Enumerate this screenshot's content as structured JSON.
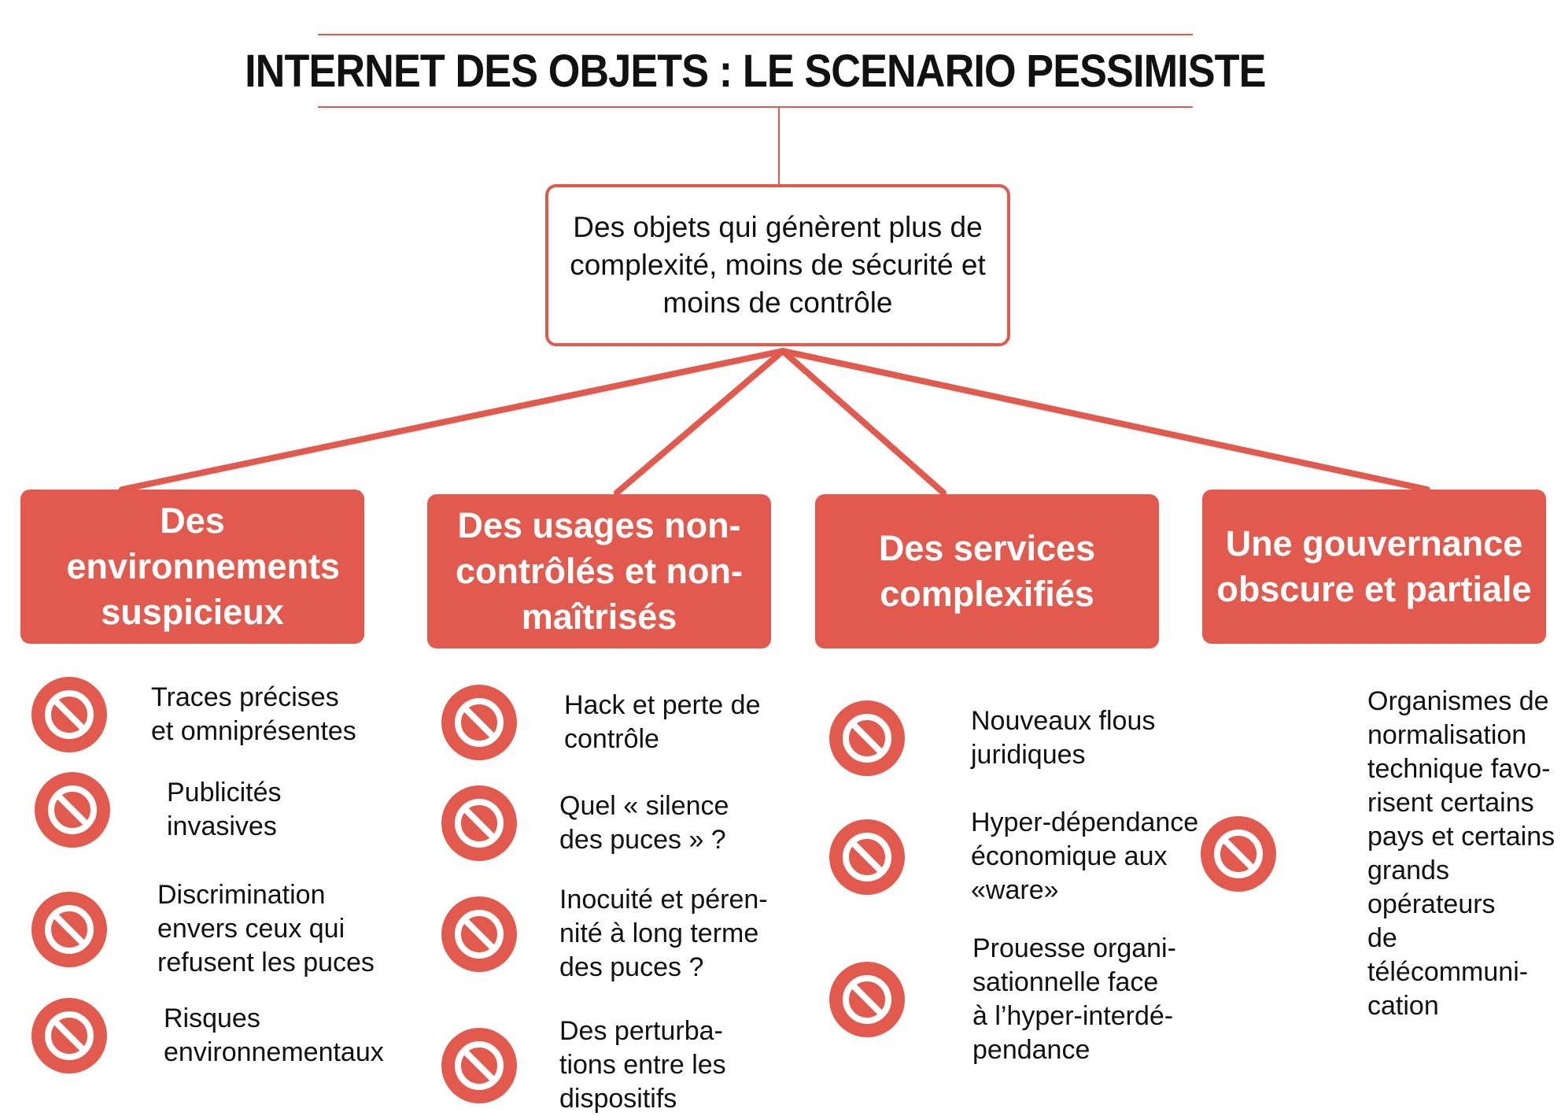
{
  "title": "INTERNET DES OBJETS : LE SCENARIO PESSIMISTE",
  "root": "Des objets qui génèrent plus de complexité, moins de sécurité et moins de contrôle",
  "colors": {
    "accent": "#e25a4d",
    "text": "#111111",
    "background": "#ffffff"
  },
  "icon_name": "no-entry-icon",
  "branches": [
    {
      "label": "Des environnements suspicieux",
      "items": [
        "Traces précises\net omniprésentes",
        "Publicités\ninvasives",
        "Discrimination\nenvers ceux qui\nrefusent les puces",
        "Risques\nenvironnementaux"
      ]
    },
    {
      "label": "Des usages non-contrôlés et non-maîtrisés",
      "items": [
        "Hack et perte de\ncontrôle",
        "Quel « silence\ndes puces » ?",
        "Inocuité et péren-\nnité à long terme\ndes puces ?",
        "Des perturba-\ntions entre les\ndispositifs"
      ]
    },
    {
      "label": "Des services complexifiés",
      "items": [
        "Nouveaux flous\njuridiques",
        "Hyper-dépendance\néconomique aux\n«ware»",
        "Prouesse organi-\nsationnelle face\nà l’hyper-interdé-\npendance"
      ]
    },
    {
      "label": "Une gouvernance obscure et partiale",
      "items": [
        "Organismes de\nnormalisation\ntechnique favo-\nrisent certains\npays et certains\ngrands opérateurs\nde télécommuni-\ncation"
      ]
    }
  ]
}
